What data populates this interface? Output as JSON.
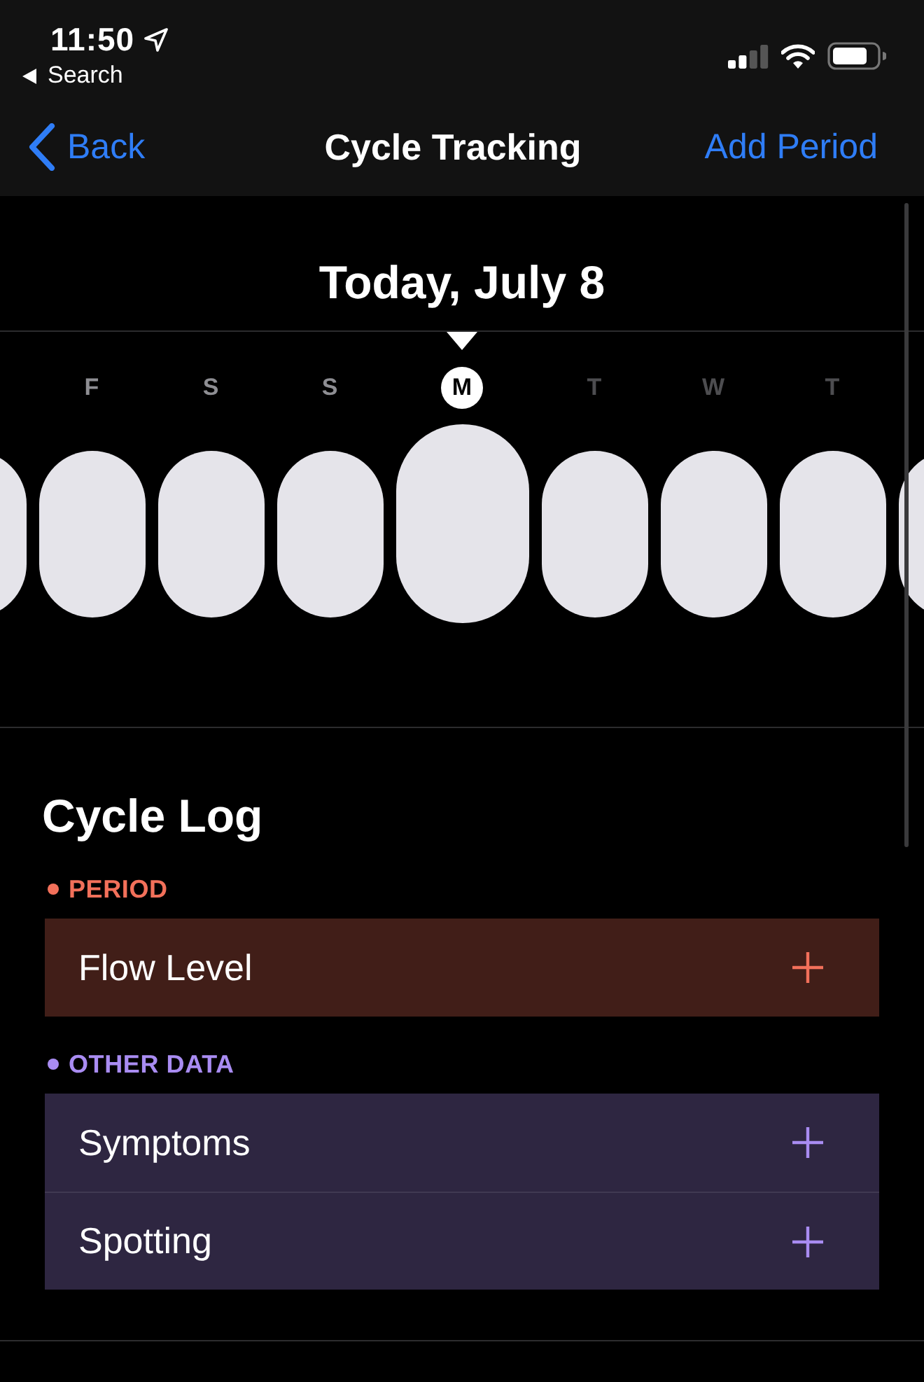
{
  "status_bar": {
    "time": "11:50",
    "back_to_app": "Search"
  },
  "nav_bar": {
    "back": "Back",
    "title": "Cycle Tracking",
    "action": "Add Period"
  },
  "date_title": "Today, July 8",
  "days": [
    {
      "selected": false
    },
    {
      "letter": "F",
      "selected": false,
      "future": false
    },
    {
      "letter": "S",
      "selected": false,
      "future": false
    },
    {
      "letter": "S",
      "selected": false,
      "future": false
    },
    {
      "letter": "M",
      "selected": true,
      "future": false
    },
    {
      "letter": "T",
      "selected": false,
      "future": true
    },
    {
      "letter": "W",
      "selected": false,
      "future": true
    },
    {
      "letter": "T",
      "selected": false,
      "future": true
    },
    {
      "selected": false
    }
  ],
  "cycle_log": {
    "title": "Cycle Log",
    "sections": [
      {
        "label": "PERIOD",
        "color": "#f2705a",
        "rows": [
          {
            "label": "Flow Level"
          }
        ]
      },
      {
        "label": "OTHER DATA",
        "color": "#a98cf2",
        "rows": [
          {
            "label": "Symptoms"
          },
          {
            "label": "Spotting"
          }
        ]
      }
    ]
  }
}
